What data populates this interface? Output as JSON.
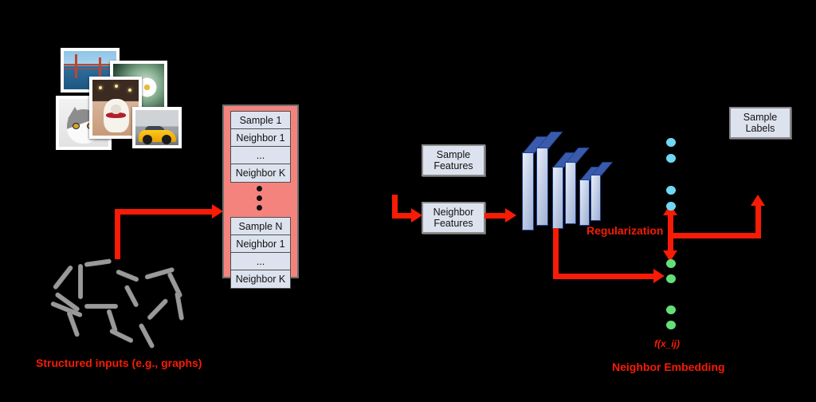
{
  "diagram": {
    "title_hidden": "",
    "captions": {
      "structured_inputs": "Structured inputs (e.g., graphs)",
      "neighbor_embedding": "Neighbor Embedding",
      "embedding_formula": "f(x_ij)",
      "regularization": "Regularization"
    },
    "colors": {
      "accent_red": "#f81b05",
      "queue_fill": "#f4837e",
      "cell_fill": "#dde3ee",
      "box_fill": "#dde3ee",
      "slab_face": "#c3cfe6",
      "slab_edge": "#1f3f8f",
      "dot_blue": "#6fd8f2",
      "dot_green": "#63e07a",
      "graph_edge": "#9a9a9a"
    },
    "photos": [
      {
        "name": "golden-gate-bridge",
        "alt": "bridge"
      },
      {
        "name": "daisy-flower",
        "alt": "daisy"
      },
      {
        "name": "gray-white-cat",
        "alt": "cat"
      },
      {
        "name": "bulldog-puppy",
        "alt": "dog"
      },
      {
        "name": "yellow-sports-car",
        "alt": "car"
      }
    ],
    "queue": {
      "group_one": [
        "Sample 1",
        "Neighbor 1",
        "...",
        "Neighbor K"
      ],
      "ellipsis_dots": 3,
      "group_two": [
        "Sample N",
        "Neighbor 1",
        "...",
        "Neighbor K"
      ]
    },
    "inputs": [
      {
        "id": "sample-features",
        "line1": "Sample",
        "line2": "Features"
      },
      {
        "id": "neighbor-features",
        "line1": "Neighbor",
        "line2": "Features"
      }
    ],
    "network": {
      "name": "cnn-stack",
      "slab_count": 6
    },
    "outputs": {
      "sample_labels": {
        "line1": "Sample",
        "line2": "Labels"
      },
      "blue_dots": 4,
      "green_dots": 4
    }
  }
}
